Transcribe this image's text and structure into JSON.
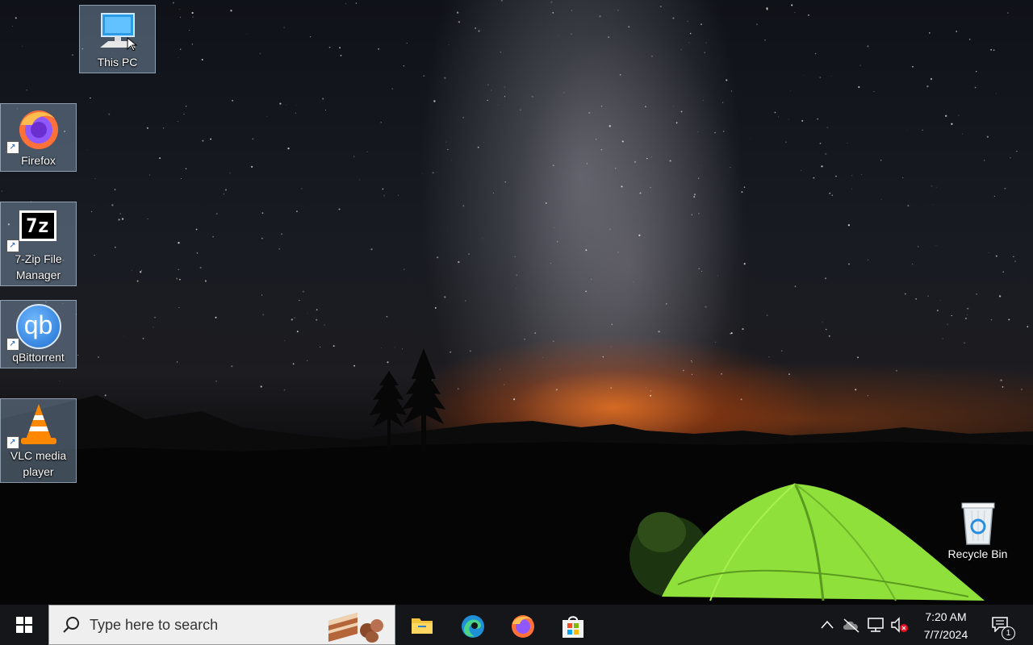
{
  "desktop": {
    "icons": [
      {
        "label": "This PC",
        "icon": "this-pc-icon"
      },
      {
        "label": "Firefox",
        "icon": "firefox-icon"
      },
      {
        "label": "7-Zip File Manager",
        "icon": "7zip-icon",
        "glyph_text": "7z"
      },
      {
        "label": "qBittorrent",
        "icon": "qbittorrent-icon",
        "glyph_text": "qb"
      },
      {
        "label": "VLC media player",
        "icon": "vlc-icon"
      },
      {
        "label": "Recycle Bin",
        "icon": "recycle-bin-icon"
      }
    ]
  },
  "taskbar": {
    "start": "windows-logo-icon",
    "search": {
      "placeholder": "Type here to search"
    },
    "pinned": [
      {
        "name": "File Explorer",
        "icon": "file-explorer-icon"
      },
      {
        "name": "Microsoft Edge",
        "icon": "edge-icon"
      },
      {
        "name": "Firefox",
        "icon": "firefox-icon"
      },
      {
        "name": "Microsoft Store",
        "icon": "store-icon"
      }
    ],
    "tray": {
      "icons": [
        "chevron-up-icon",
        "onedrive-offline-icon",
        "network-icon",
        "volume-muted-icon"
      ],
      "time": "7:20 AM",
      "date": "7/7/2024",
      "notification_count": "1"
    }
  },
  "colors": {
    "taskbar": "#15161a",
    "search_box": "#efefef",
    "selection": "#96b4d2",
    "tent_green": "#8fe03a"
  }
}
